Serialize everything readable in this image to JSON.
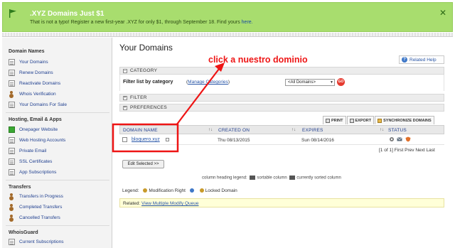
{
  "banner": {
    "title": ".XYZ Domains Just $1",
    "message": "That is not a typo! Register a new first-year .XYZ for only $1, through September 18. Find yours",
    "link": "here.",
    "close": "✕"
  },
  "sidebar": {
    "sections": [
      {
        "title": "Domain Names",
        "items": [
          "Your Domains",
          "Renew Domains",
          "Reactivate Domains",
          "Whois Verification",
          "Your Domains For Sale"
        ]
      },
      {
        "title": "Hosting, Email & Apps",
        "items": [
          "Onepager Website",
          "Web Hosting Accounts",
          "Private Email",
          "SSL Certificates",
          "App Subscriptions"
        ]
      },
      {
        "title": "Transfers",
        "items": [
          "Transfers in Progress",
          "Completed Transfers",
          "Cancelled Transfers"
        ]
      },
      {
        "title": "WhoisGuard",
        "items": [
          "Current Subscriptions"
        ]
      }
    ]
  },
  "main": {
    "title": "Your Domains",
    "annotation": "click a nuestro dominio",
    "related_help": "Related Help",
    "category_header": "CATEGORY",
    "filter_label": "Filter list by category",
    "manage_open": "(",
    "manage_link": "Manage Categories",
    "manage_close": ")",
    "category_select": "<All Domains>",
    "go_label": "GO",
    "filter_header": "FILTER",
    "preferences_header": "PREFERENCES"
  },
  "toolbar": {
    "print": "PRINT",
    "export": "EXPORT",
    "sync": "SYNCHRONIZE DOMAINS"
  },
  "table": {
    "headers": {
      "domain": "DOMAIN NAME",
      "created": "CREATED ON",
      "expires": "EXPIRES",
      "status": "STATUS"
    },
    "sort_icon": "↑↓",
    "rows": [
      {
        "domain": "bloquero.xyz",
        "created": "Thu 08/13/2015",
        "expires": "Sun 08/14/2016"
      }
    ]
  },
  "pager": {
    "range": "[1 of 1]",
    "first": "First",
    "prev": "Prev",
    "next": "Next",
    "last": "Last"
  },
  "edit_selected": "Edit Selected >>",
  "legend": {
    "column_text": "column heading legend:",
    "sortable": "sortable column",
    "sorted": "currently sorted column",
    "label": "Legend:",
    "modification": "Modification Right",
    "locked": "Locked Domain"
  },
  "related": {
    "label": "Related:",
    "link": "View Multiple Modify Queue"
  },
  "colors": {
    "banner_bg": "#a8dd6e",
    "link": "#2a57a8",
    "annotation": "#ee1515"
  }
}
